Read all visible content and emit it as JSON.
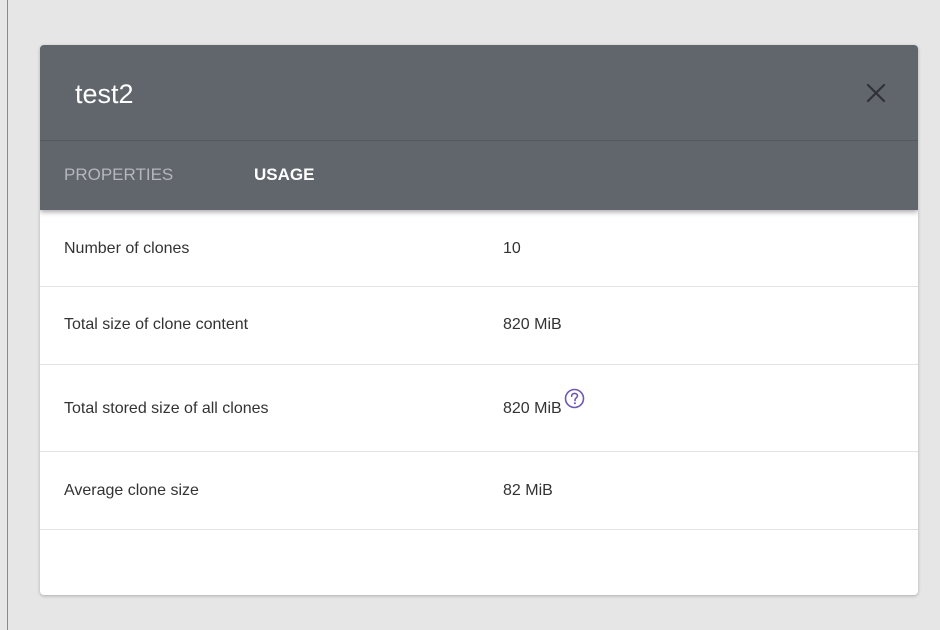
{
  "dialog": {
    "title": "test2",
    "close_icon": "close-icon",
    "tabs": [
      {
        "label": "PROPERTIES",
        "active": false
      },
      {
        "label": "USAGE",
        "active": true
      }
    ]
  },
  "usage": {
    "rows": [
      {
        "label": "Number of clones",
        "value": "10"
      },
      {
        "label": "Total size of clone content",
        "value": "820 MiB"
      },
      {
        "label": "Total stored size of all clones",
        "value": "820 MiB",
        "help_icon": "help-circle-icon"
      },
      {
        "label": "Average clone size",
        "value": "82 MiB"
      }
    ]
  },
  "colors": {
    "header_bg": "#61656c",
    "accent": "#7057b0",
    "page_bg": "#e6e6e6"
  }
}
